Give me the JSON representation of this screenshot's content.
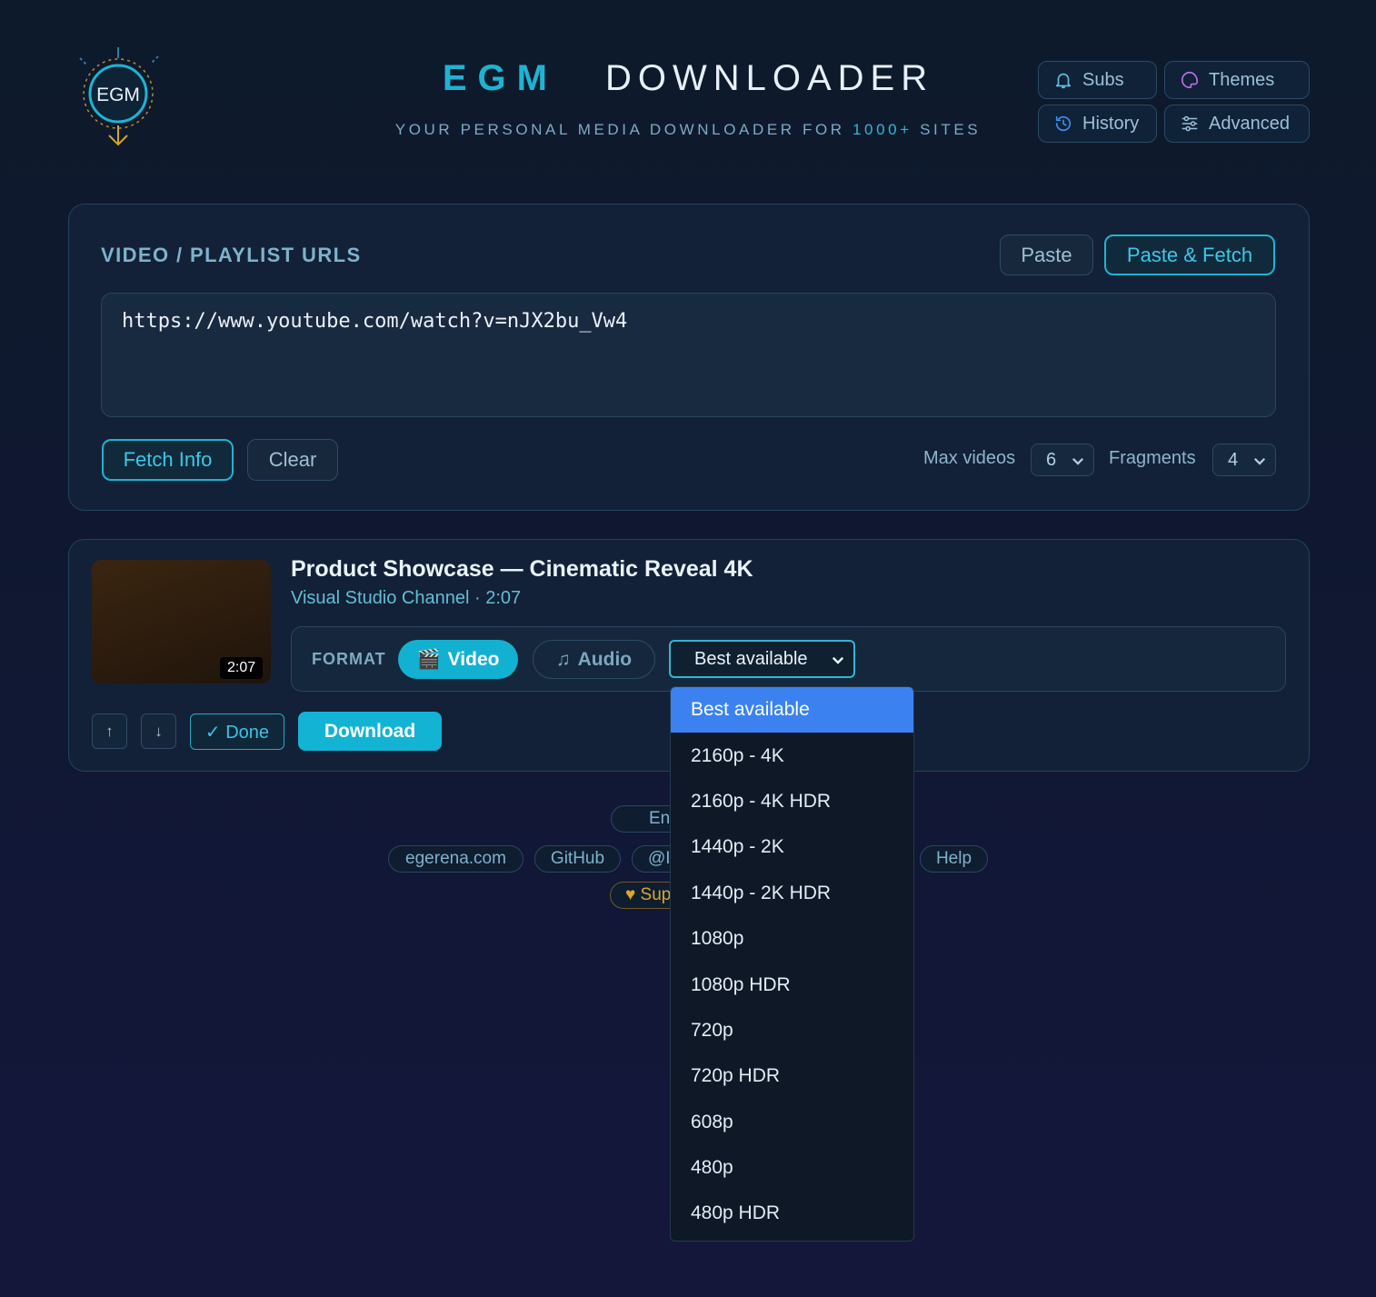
{
  "header": {
    "logo_text": "EGM",
    "title_part1": "EGM",
    "title_part2": "DOWNLOADER",
    "subtitle_pre": "YOUR PERSONAL MEDIA DOWNLOADER FOR ",
    "subtitle_highlight": "1000+",
    "subtitle_post": " SITES",
    "buttons": {
      "subs": "Subs",
      "themes": "Themes",
      "history": "History",
      "advanced": "Advanced"
    }
  },
  "urls": {
    "section_title": "VIDEO / PLAYLIST URLS",
    "paste_label": "Paste",
    "paste_fetch_label": "Paste & Fetch",
    "url_value": "https://www.youtube.com/watch?v=nJX2bu_Vw4",
    "fetch_info_label": "Fetch Info",
    "clear_label": "Clear",
    "max_videos_label": "Max videos",
    "max_videos_value": "6",
    "fragments_label": "Fragments",
    "fragments_value": "4"
  },
  "video": {
    "title": "Product Showcase — Cinematic Reveal 4K",
    "meta": "Visual Studio Channel · 2:07",
    "duration": "2:07",
    "format_label": "FORMAT",
    "video_tab": "Video",
    "video_icon": "🎬",
    "audio_tab": "Audio",
    "audio_icon": "♫",
    "quality_selected": "Best available",
    "up_label": "↑",
    "down_label": "↓",
    "done_label": "✓ Done",
    "download_label": "Download"
  },
  "quality_options": [
    "Best available",
    "2160p - 4K",
    "2160p - 4K HDR",
    "1440p - 2K",
    "1440p - 2K HDR",
    "1080p",
    "1080p HDR",
    "720p",
    "720p HDR",
    "608p",
    "480p",
    "480p HDR"
  ],
  "footer": {
    "lang_partial": "En",
    "links": {
      "site": "egerena.com",
      "github": "GitHub",
      "handle_partial": "@I",
      "help": "Help"
    },
    "support_partial": "♥ Sup"
  },
  "colors": {
    "accent": "#1fb3d2",
    "selected_option": "#3b82f0",
    "support_gold": "#d8a82b"
  }
}
